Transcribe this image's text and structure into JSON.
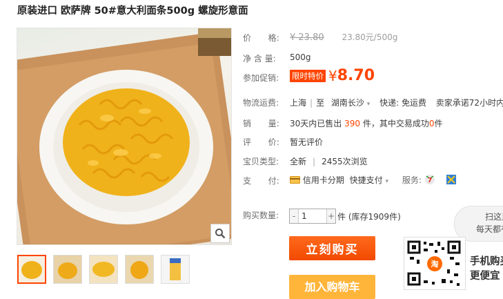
{
  "title": "原装进口 欧萨牌 50#意大利面条500g 螺旋形意面",
  "price": {
    "label": "价　　格:",
    "original": "¥ 23.80",
    "unit_price": "23.80元/500g"
  },
  "net_content": {
    "label": "净 含 量:",
    "value": "500g"
  },
  "promo": {
    "label": "参加促销:",
    "tag": "限时特价",
    "currency": "¥",
    "price": "8.70"
  },
  "shipping": {
    "label": "物流运费:",
    "from": "上海",
    "to_prefix": "至",
    "to": "湖南长沙",
    "delivery": "快递: 免运费",
    "promise": "卖家承诺72小时内发货"
  },
  "sales": {
    "label": "销　　量:",
    "prefix": "30天内已售出",
    "sold": "390",
    "mid": "件，其中交易成功",
    "success": "0",
    "suffix": "件"
  },
  "rating": {
    "label": "评　　价:",
    "value": "暂无评价"
  },
  "type": {
    "label": "宝贝类型:",
    "condition": "全新",
    "views": "2455次浏览"
  },
  "payment": {
    "label": "支　　付:",
    "installment": "信用卡分期",
    "quickpay": "快捷支付",
    "services_label": "服务:"
  },
  "quantity": {
    "label": "购买数量:",
    "value": "1",
    "stock_unit": "件",
    "stock": "(库存1909件)"
  },
  "buttons": {
    "buy_now": "立刻购买",
    "add_cart": "加入购物车"
  },
  "scan": {
    "line1": "扫这里",
    "line2": "每天都有"
  },
  "mobile": {
    "line1": "手机购买",
    "line2": "更便宜"
  },
  "colors": {
    "accent": "#ff4400",
    "cart": "#ffb53a",
    "label": "#6c6c6c"
  }
}
